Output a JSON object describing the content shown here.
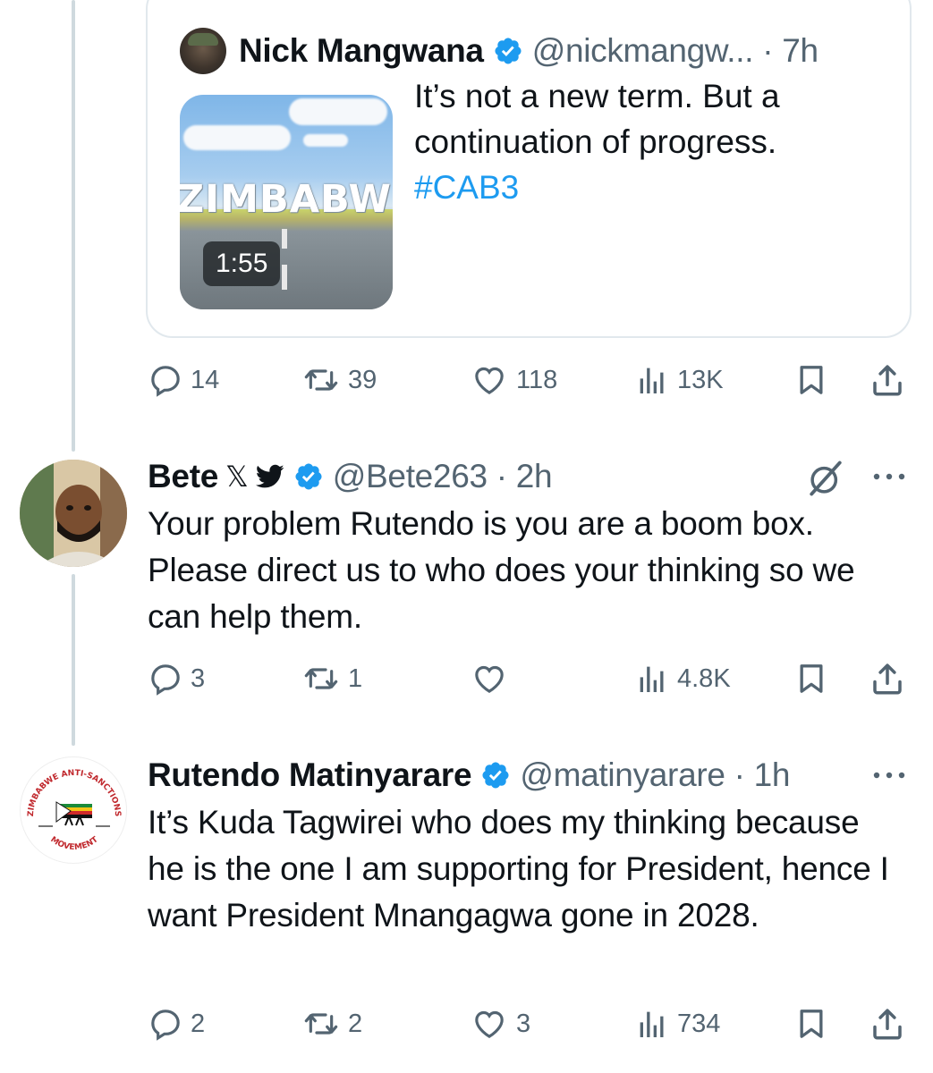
{
  "quote": {
    "name": "Nick Mangwana",
    "handle": "@nickmangw... · 7h",
    "text_1": "It’s not a new term. But a continuation of progress.",
    "hashtag": "#CAB3",
    "video_title": "ZIMBABWE",
    "video_duration": "1:55"
  },
  "tweet0_actions": {
    "replies": "14",
    "reposts": "39",
    "likes": "118",
    "views": "13K"
  },
  "tweet1": {
    "name": "Bete",
    "x_glyph": "𝕏",
    "handle": "@Bete263 · 2h",
    "text": "Your problem Rutendo is you are a boom box. Please direct us to who does your thinking so we can help them.",
    "actions": {
      "replies": "3",
      "reposts": "1",
      "likes": "",
      "views": "4.8K"
    }
  },
  "tweet2": {
    "name": "Rutendo Matinyarare",
    "handle": "@matinyarare · 1h",
    "avatar_text_top": "ZIMBABWE ANTI-SANCTIONS",
    "avatar_text_bottom": "MOVEMENT",
    "text": "It’s Kuda Tagwirei who does my thinking because he is the one I am supporting for President, hence I want President Mnangagwa gone in 2028.",
    "actions": {
      "replies": "2",
      "reposts": "2",
      "likes": "3",
      "views": "734"
    }
  },
  "colors": {
    "accent": "#1d9bf0",
    "muted": "#536471",
    "text": "#0f1419",
    "thread_line": "#cfd9de"
  },
  "icons": [
    "reply-icon",
    "repost-icon",
    "like-icon",
    "views-icon",
    "bookmark-icon",
    "share-icon",
    "verified-badge-icon",
    "more-icon",
    "grok-icon",
    "bird-icon"
  ]
}
